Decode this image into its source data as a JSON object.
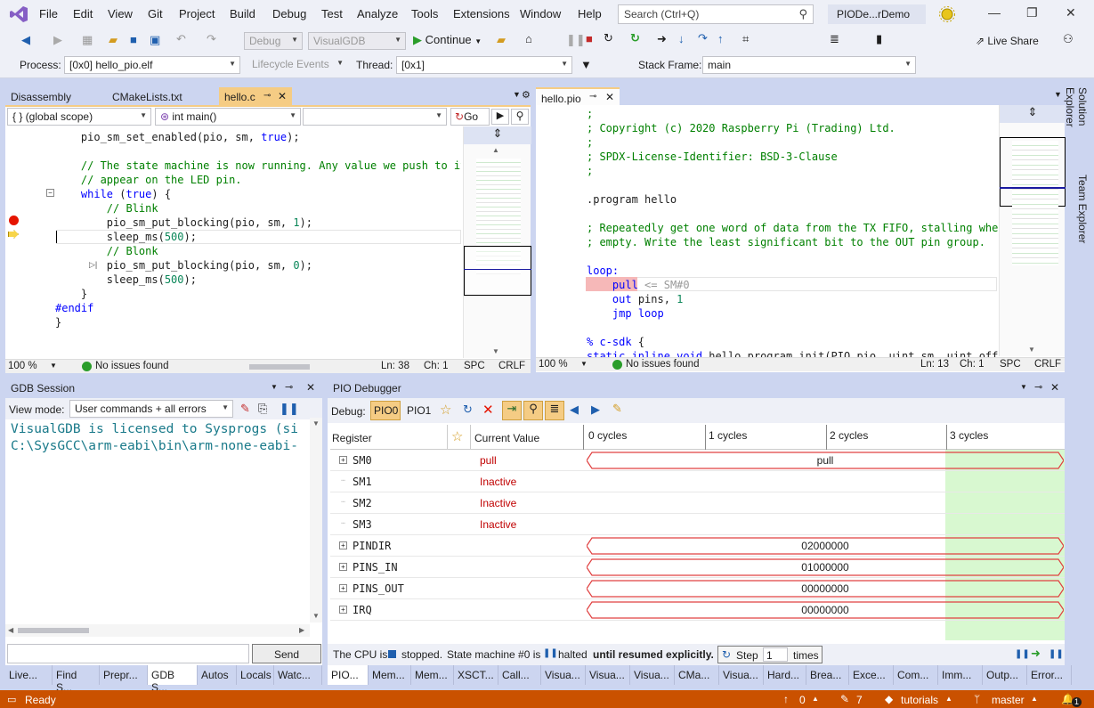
{
  "menu": [
    "File",
    "Edit",
    "View",
    "Git",
    "Project",
    "Build",
    "Debug",
    "Test",
    "Analyze",
    "Tools",
    "Extensions",
    "Window",
    "Help"
  ],
  "search_placeholder": "Search (Ctrl+Q)",
  "project_name": "PIODe...rDemo",
  "toolbar1": {
    "config": "Debug",
    "platform": "VisualGDB",
    "continue": "Continue",
    "live_share": "Live Share"
  },
  "toolbar2": {
    "process_label": "Process:",
    "process_value": "[0x0] hello_pio.elf",
    "lifecycle": "Lifecycle Events",
    "thread_label": "Thread:",
    "thread_value": "[0x1]",
    "stack_label": "Stack Frame:",
    "stack_value": "main"
  },
  "left_editor": {
    "tabs": [
      "Disassembly",
      "CMakeLists.txt",
      "hello.c"
    ],
    "scope": "{ } (global scope)",
    "function": "int main()",
    "go": "Go",
    "zoom": "100 %",
    "issues": "No issues found",
    "ln": "Ln: 38",
    "ch": "Ch: 1",
    "spc": "SPC",
    "crlf": "CRLF"
  },
  "right_editor": {
    "tab": "hello.pio",
    "zoom": "100 %",
    "issues": "No issues found",
    "ln": "Ln: 13",
    "ch": "Ch: 1",
    "spc": "SPC",
    "crlf": "CRLF"
  },
  "side_tabs": [
    "Solution Explorer",
    "Team Explorer"
  ],
  "gdb": {
    "title": "GDB Session",
    "view_mode_label": "View mode:",
    "view_mode_value": "User commands + all errors",
    "lines": [
      "VisualGDB is licensed to Sysprogs (si",
      "C:\\SysGCC\\arm-eabi\\bin\\arm-none-eabi-"
    ],
    "send": "Send"
  },
  "pio": {
    "title": "PIO Debugger",
    "debug_label": "Debug:",
    "tabs": [
      "PIO0",
      "PIO1"
    ],
    "col_register": "Register",
    "col_value": "Current Value",
    "cycles": [
      "0 cycles",
      "1 cycles",
      "2 cycles",
      "3 cycles"
    ],
    "rows": [
      {
        "name": "SM0",
        "value": "pull",
        "wave": "pull",
        "expand": true
      },
      {
        "name": "SM1",
        "value": "Inactive",
        "wave": "",
        "expand": false
      },
      {
        "name": "SM2",
        "value": "Inactive",
        "wave": "",
        "expand": false
      },
      {
        "name": "SM3",
        "value": "Inactive",
        "wave": "",
        "expand": false
      },
      {
        "name": "PINDIR",
        "value": "",
        "wave": "02000000",
        "expand": true
      },
      {
        "name": "PINS_IN",
        "value": "",
        "wave": "01000000",
        "expand": true
      },
      {
        "name": "PINS_OUT",
        "value": "",
        "wave": "00000000",
        "expand": true
      },
      {
        "name": "IRQ",
        "value": "",
        "wave": "00000000",
        "expand": true
      }
    ],
    "status_prefix": "The CPU is",
    "status_stopped": "stopped.",
    "status_mid": "State machine #0 is",
    "status_halted": "halted",
    "status_until": "until resumed explicitly.",
    "step": "Step",
    "step_count": "1",
    "times": "times"
  },
  "bottom_left_tabs": [
    "Live...",
    "Find S...",
    "Prepr...",
    "GDB S...",
    "Autos",
    "Locals",
    "Watc..."
  ],
  "bottom_right_tabs": [
    "PIO...",
    "Mem...",
    "Mem...",
    "XSCT...",
    "Call...",
    "Visua...",
    "Visua...",
    "Visua...",
    "CMa...",
    "Visua...",
    "Hard...",
    "Brea...",
    "Exce...",
    "Com...",
    "Imm...",
    "Outp...",
    "Error..."
  ],
  "status": {
    "ready": "Ready",
    "up": "0",
    "edits": "7",
    "branch_repo": "tutorials",
    "branch": "master",
    "notif": "1"
  },
  "colors": {
    "accent": "#ca5100",
    "tab_active": "#f5cc84",
    "error": "#c00000",
    "wave_fill": "#d8f8d0"
  }
}
